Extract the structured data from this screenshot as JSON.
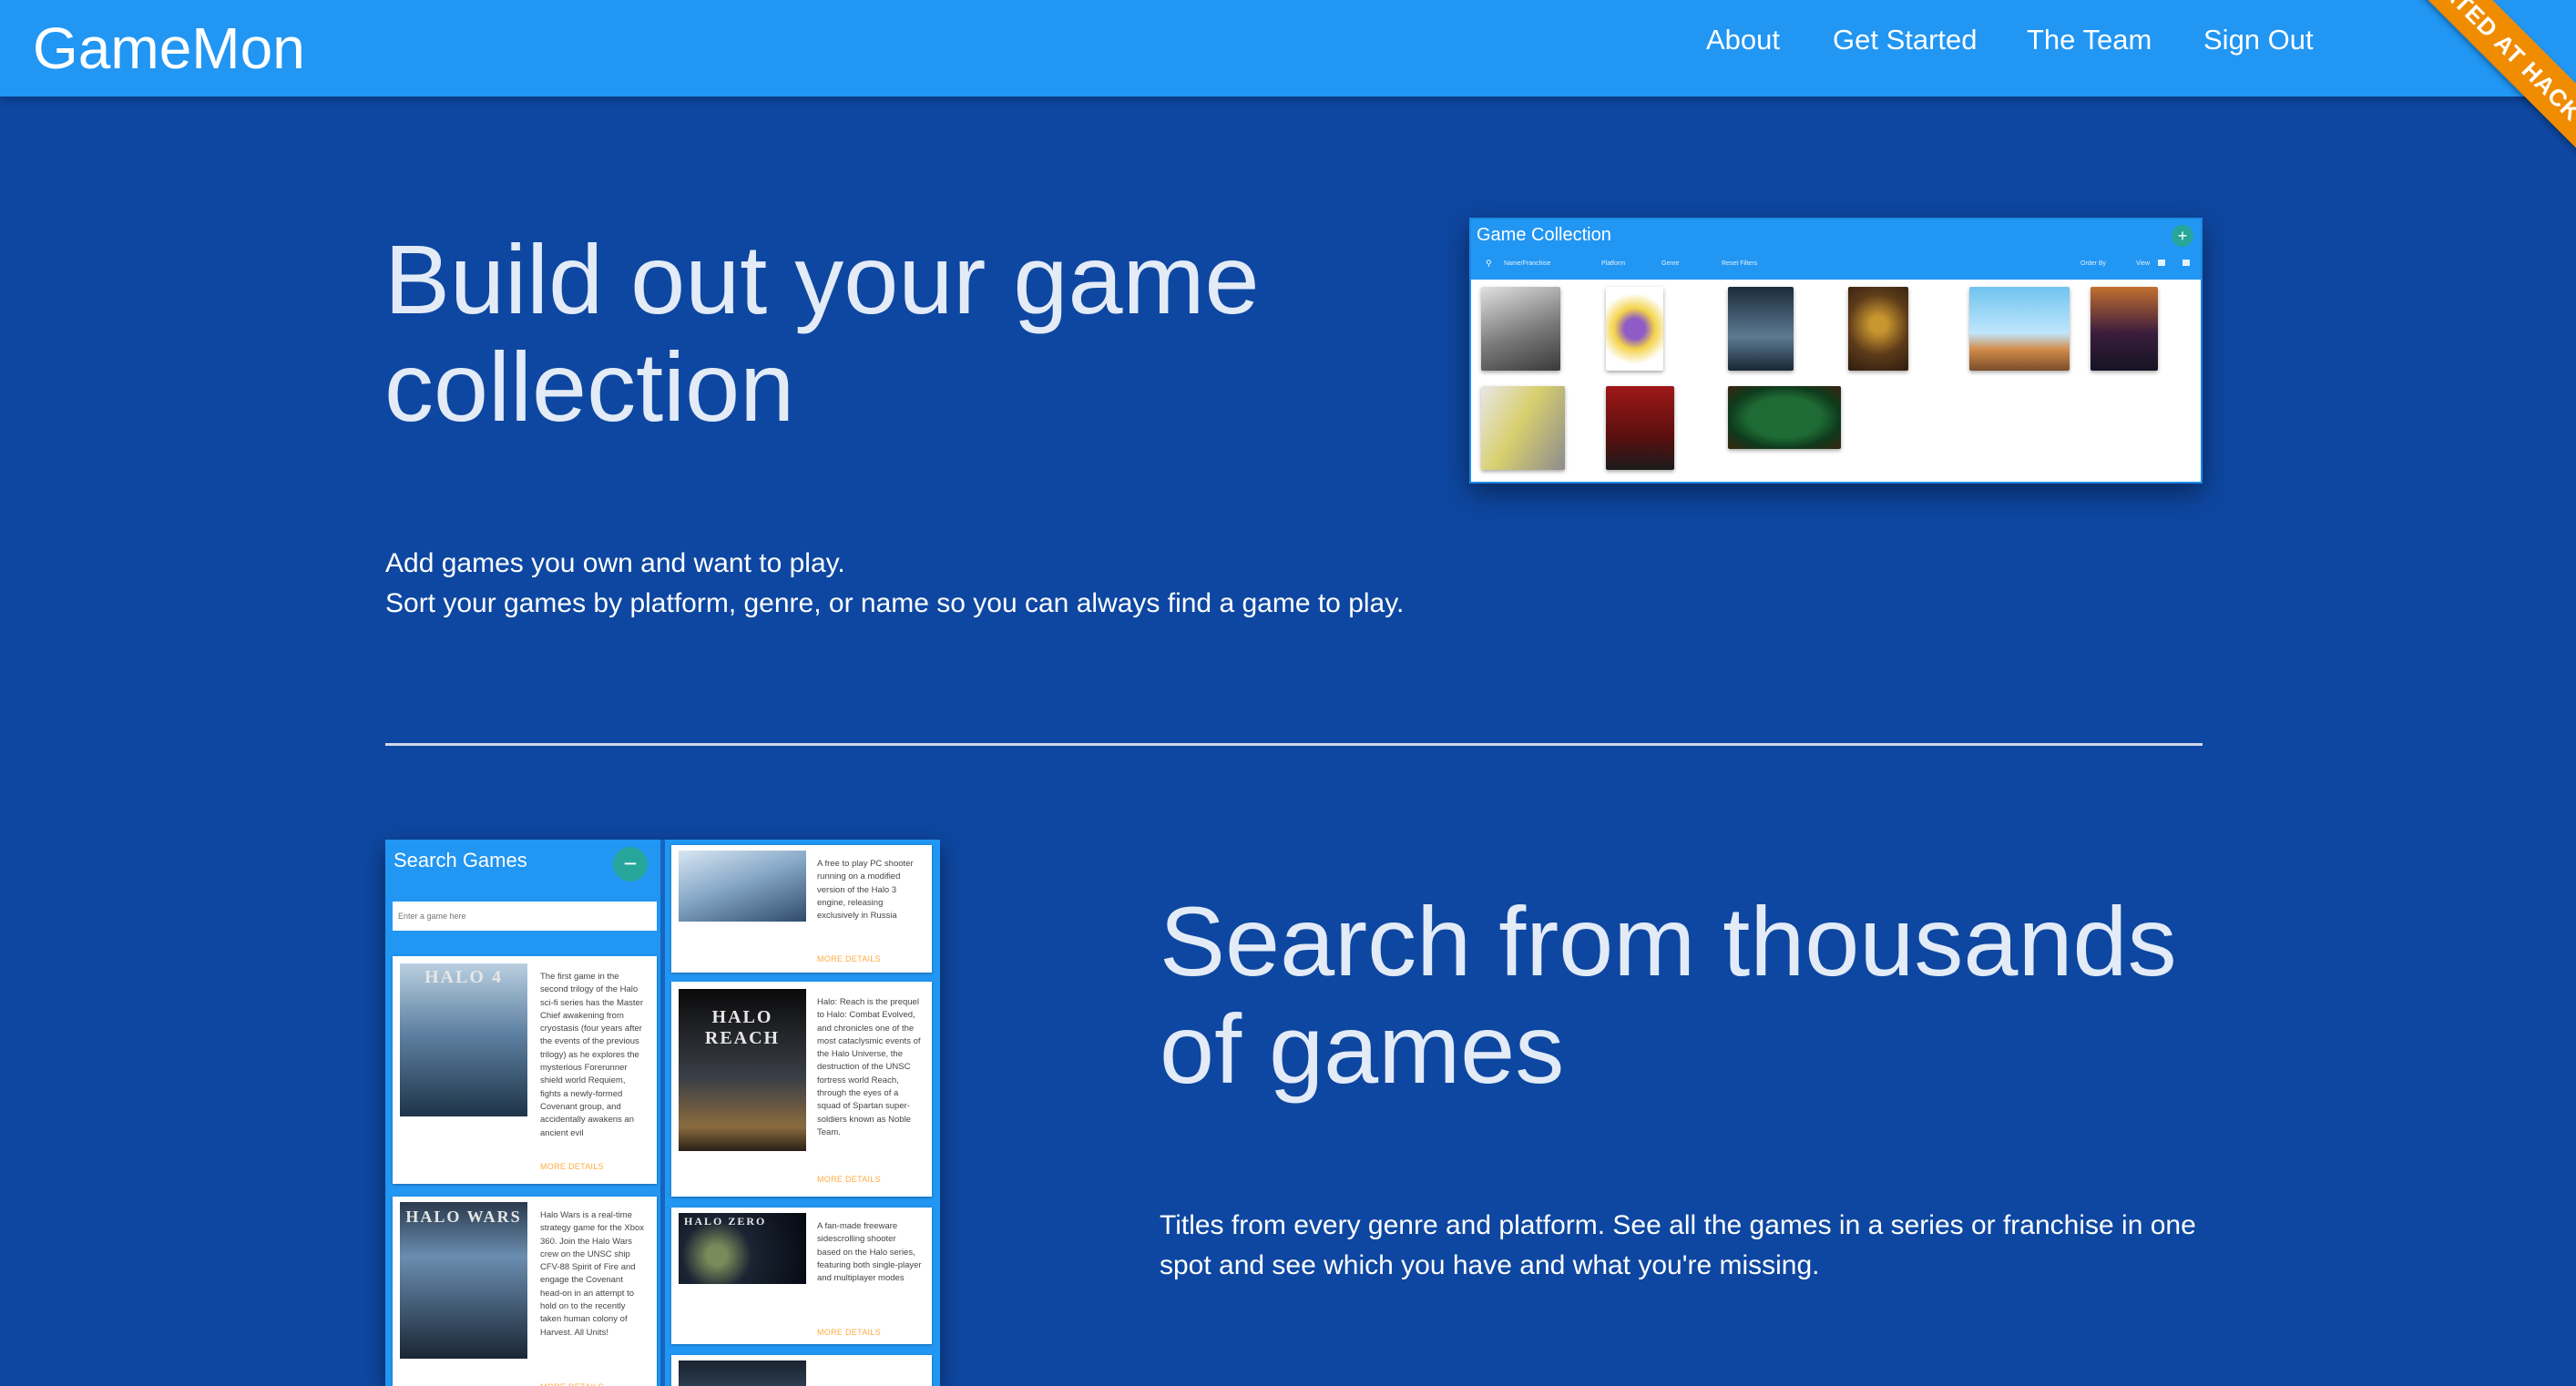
{
  "nav": {
    "brand": "GameMon",
    "links": [
      "About",
      "Get Started",
      "The Team",
      "Sign Out"
    ],
    "ribbon": "CREATED AT HACK REACTOR"
  },
  "section1": {
    "title": "Build out your game collection",
    "desc_line1": "Add games you own and want to play.",
    "desc_line2": "Sort your games by platform, genre, or name so you can always find a game to play."
  },
  "collection": {
    "title": "Game Collection",
    "add_icon": "+",
    "search_placeholder": "Name/Franchise",
    "filters": [
      "Platform",
      "Genre",
      "Reset Filters"
    ],
    "order_by": "Order By",
    "view_label": "View",
    "icons": [
      "search-icon",
      "plus-icon",
      "grid-view-icon",
      "list-view-icon"
    ]
  },
  "section2": {
    "title": "Search from thousands of games",
    "desc": "Titles from every genre and platform. See all the games in a series or franchise in one spot and see which you have and what you're missing."
  },
  "search_panel": {
    "title": "Search Games",
    "minus_icon": "−",
    "placeholder": "Enter a game here",
    "more_label": "MORE DETAILS",
    "cards": [
      {
        "cover": "HALO 4",
        "text": "The first game in the second trilogy of the Halo sci-fi series has the Master Chief awakening from cryostasis (four years after the events of the previous trilogy) as he explores the mysterious Forerunner shield world Requiem, fights a newly-formed Covenant group, and accidentally awakens an ancient evil"
      },
      {
        "cover": "HALO WARS",
        "text": "Halo Wars is a real-time strategy game for the Xbox 360. Join the Halo Wars crew on the UNSC ship CFV-88 Spirit of Fire and engage the Covenant head-on in an attempt to hold on to the recently taken human colony of Harvest. All Units!"
      },
      {
        "cover": "",
        "text": "A free to play PC shooter running on a modified version of the Halo 3 engine, releasing exclusively in Russia"
      },
      {
        "cover": "HALO REACH",
        "text": "Halo: Reach is the prequel to Halo: Combat Evolved, and chronicles one of the most cataclysmic events of the Halo Universe, the destruction of the UNSC fortress world Reach, through the eyes of a squad of Spartan super-soldiers known as Noble Team."
      },
      {
        "cover": "HALO ZERO",
        "text": "A fan-made freeware sidescrolling shooter based on the Halo series, featuring both single-player and multiplayer modes"
      }
    ]
  },
  "colors": {
    "page_bg": "#0e47a1",
    "navbar_bg": "#2196f3",
    "accent_teal": "#26a69a",
    "ribbon_orange": "#f08c00",
    "more_link": "#ffab40"
  }
}
